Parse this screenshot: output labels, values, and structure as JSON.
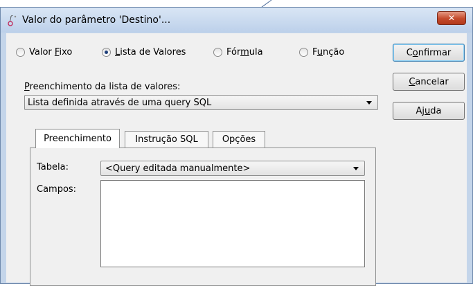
{
  "window": {
    "title": "Valor do parâmetro 'Destino'...",
    "close_symbol": "✕"
  },
  "value_type": {
    "options": [
      {
        "label_pre": "Valor ",
        "accel": "F",
        "label_post": "ixo",
        "selected": false
      },
      {
        "label_pre": "",
        "accel": "L",
        "label_post": "ista de Valores",
        "selected": true
      },
      {
        "label_pre": "Fór",
        "accel": "m",
        "label_post": "ula",
        "selected": false
      },
      {
        "label_pre": "F",
        "accel": "u",
        "label_post": "nção",
        "selected": false
      }
    ]
  },
  "buttons": {
    "confirm": {
      "pre": "C",
      "accel": "o",
      "post": "nfirmar"
    },
    "cancel": {
      "pre": "",
      "accel": "C",
      "post": "ancelar"
    },
    "help": {
      "pre": "Aj",
      "accel": "u",
      "post": "da"
    }
  },
  "fill_list": {
    "label_pre": "",
    "label_accel": "P",
    "label_post": "reenchimento da lista de valores:",
    "selected": "Lista definida através de uma query SQL"
  },
  "tabs": [
    {
      "label": "Preenchimento",
      "active": true
    },
    {
      "label": "Instrução SQL",
      "active": false
    },
    {
      "label": "Opções",
      "active": false
    }
  ],
  "panel": {
    "table_label": "Tabela:",
    "table_value": "<Query editada manualmente>",
    "fields_label": "Campos:",
    "fields_value": ""
  },
  "colors": {
    "title_bar": "#c4d5ea",
    "close_button": "#c44a2c",
    "dialog_bg": "#f0f0f0",
    "radio_selected": "#1e3f7a"
  }
}
